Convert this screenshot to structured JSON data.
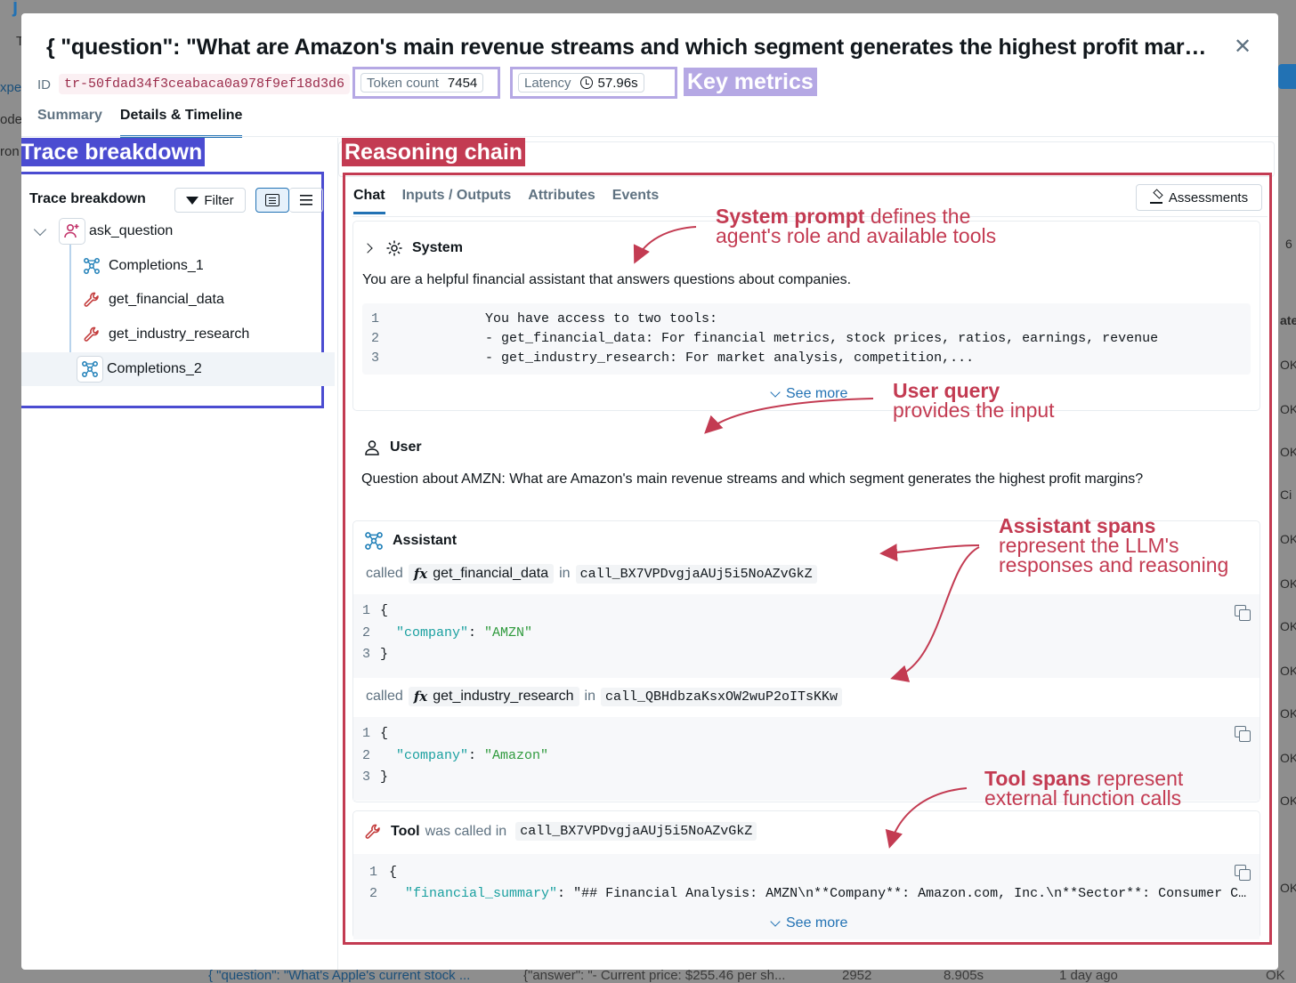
{
  "background": {
    "left_fragments": [
      "j",
      "T",
      "xpe",
      "ode",
      "ron"
    ],
    "right_fragments": [
      "6",
      "ate",
      "OK",
      "OK",
      "OK",
      "Ci",
      "OK",
      "OK",
      "OK",
      "OK",
      "OK",
      "OK",
      "OK",
      "OK"
    ],
    "bottom_row": {
      "question": "{ \"question\": \"What's Apple's current stock ...",
      "answer": "{\"answer\": \"- Current price: $255.46 per sh...",
      "tokens": "2952",
      "latency": "8.905s",
      "time": "1 day ago",
      "status": "OK"
    }
  },
  "modal": {
    "title": "{ \"question\": \"What are Amazon's main revenue streams and which segment generates the highest profit margins?\" }",
    "id_label": "ID",
    "id_value": "tr-50fdad34f3ceabaca0a978f9ef18d3d6",
    "token_count_label": "Token count",
    "token_count_value": "7454",
    "latency_label": "Latency",
    "latency_value": "57.96s",
    "tabs": [
      "Summary",
      "Details & Timeline"
    ],
    "active_tab": "Details & Timeline"
  },
  "annotations": {
    "key_metrics": "Key metrics",
    "trace_breakdown": "Trace breakdown",
    "reasoning_chain": "Reasoning chain",
    "system_bold": "System prompt",
    "system_rest1": " defines the",
    "system_line2": "agent's role and available tools",
    "user_bold": "User query",
    "user_line2": "provides the input",
    "assistant_bold": "Assistant spans",
    "assistant_line2": "represent the LLM's",
    "assistant_line3": "responses and reasoning",
    "tool_bold": "Tool spans",
    "tool_rest1": " represent",
    "tool_line2": "external function calls"
  },
  "trace": {
    "header": "Trace breakdown",
    "filter_label": "Filter",
    "nodes": [
      {
        "label": "ask_question",
        "icon": "agent-icon"
      },
      {
        "label": "Completions_1",
        "icon": "llm-icon"
      },
      {
        "label": "get_financial_data",
        "icon": "tool-icon"
      },
      {
        "label": "get_industry_research",
        "icon": "tool-icon"
      },
      {
        "label": "Completions_2",
        "icon": "llm-icon"
      }
    ]
  },
  "chat": {
    "tabs": [
      "Chat",
      "Inputs / Outputs",
      "Attributes",
      "Events"
    ],
    "assessments_label": "Assessments",
    "system": {
      "role": "System",
      "text": "You are a helpful financial assistant that answers questions about companies.",
      "code": [
        {
          "n": "1",
          "t": "            You have access to two tools:"
        },
        {
          "n": "2",
          "t": "            - get_financial_data: For financial metrics, stock prices, ratios, earnings, revenue"
        },
        {
          "n": "3",
          "t": "            - get_industry_research: For market analysis, competition,..."
        }
      ],
      "see_more": "See more"
    },
    "user": {
      "role": "User",
      "text": "Question about AMZN: What are Amazon's main revenue streams and which segment generates the highest profit margins?"
    },
    "assistant": {
      "role": "Assistant",
      "called_word": "called",
      "in_word": "in",
      "calls": [
        {
          "fn": "get_financial_data",
          "call_id": "call_BX7VPDvgjaAUj5i5NoAZvGkZ",
          "key": "\"company\"",
          "value": "\"AMZN\""
        },
        {
          "fn": "get_industry_research",
          "call_id": "call_QBHdbzaKsxOW2wuP2oITsKKw",
          "key": "\"company\"",
          "value": "\"Amazon\""
        }
      ]
    },
    "tool": {
      "role": "Tool",
      "was_called_in": "was called in",
      "call_id": "call_BX7VPDvgjaAUj5i5NoAZvGkZ",
      "key": "\"financial_summary\"",
      "value": "\"## Financial Analysis: AMZN\\n**Company**: Amazon.com, Inc.\\n**Sector**: Consumer C…",
      "see_more": "See more"
    }
  },
  "colors": {
    "blue_annotation": "#4b4cd1",
    "red_annotation": "#c33b52",
    "purple_annotation": "#b5a8e4",
    "accent": "#2272b4"
  }
}
